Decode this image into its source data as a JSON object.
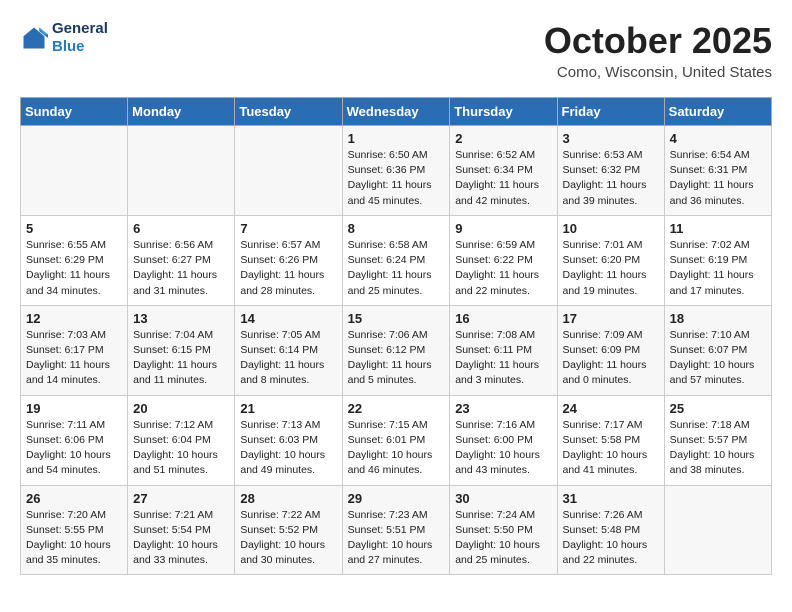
{
  "header": {
    "logo_line1": "General",
    "logo_line2": "Blue",
    "month": "October 2025",
    "location": "Como, Wisconsin, United States"
  },
  "weekdays": [
    "Sunday",
    "Monday",
    "Tuesday",
    "Wednesday",
    "Thursday",
    "Friday",
    "Saturday"
  ],
  "weeks": [
    [
      {
        "day": "",
        "text": ""
      },
      {
        "day": "",
        "text": ""
      },
      {
        "day": "",
        "text": ""
      },
      {
        "day": "1",
        "text": "Sunrise: 6:50 AM\nSunset: 6:36 PM\nDaylight: 11 hours\nand 45 minutes."
      },
      {
        "day": "2",
        "text": "Sunrise: 6:52 AM\nSunset: 6:34 PM\nDaylight: 11 hours\nand 42 minutes."
      },
      {
        "day": "3",
        "text": "Sunrise: 6:53 AM\nSunset: 6:32 PM\nDaylight: 11 hours\nand 39 minutes."
      },
      {
        "day": "4",
        "text": "Sunrise: 6:54 AM\nSunset: 6:31 PM\nDaylight: 11 hours\nand 36 minutes."
      }
    ],
    [
      {
        "day": "5",
        "text": "Sunrise: 6:55 AM\nSunset: 6:29 PM\nDaylight: 11 hours\nand 34 minutes."
      },
      {
        "day": "6",
        "text": "Sunrise: 6:56 AM\nSunset: 6:27 PM\nDaylight: 11 hours\nand 31 minutes."
      },
      {
        "day": "7",
        "text": "Sunrise: 6:57 AM\nSunset: 6:26 PM\nDaylight: 11 hours\nand 28 minutes."
      },
      {
        "day": "8",
        "text": "Sunrise: 6:58 AM\nSunset: 6:24 PM\nDaylight: 11 hours\nand 25 minutes."
      },
      {
        "day": "9",
        "text": "Sunrise: 6:59 AM\nSunset: 6:22 PM\nDaylight: 11 hours\nand 22 minutes."
      },
      {
        "day": "10",
        "text": "Sunrise: 7:01 AM\nSunset: 6:20 PM\nDaylight: 11 hours\nand 19 minutes."
      },
      {
        "day": "11",
        "text": "Sunrise: 7:02 AM\nSunset: 6:19 PM\nDaylight: 11 hours\nand 17 minutes."
      }
    ],
    [
      {
        "day": "12",
        "text": "Sunrise: 7:03 AM\nSunset: 6:17 PM\nDaylight: 11 hours\nand 14 minutes."
      },
      {
        "day": "13",
        "text": "Sunrise: 7:04 AM\nSunset: 6:15 PM\nDaylight: 11 hours\nand 11 minutes."
      },
      {
        "day": "14",
        "text": "Sunrise: 7:05 AM\nSunset: 6:14 PM\nDaylight: 11 hours\nand 8 minutes."
      },
      {
        "day": "15",
        "text": "Sunrise: 7:06 AM\nSunset: 6:12 PM\nDaylight: 11 hours\nand 5 minutes."
      },
      {
        "day": "16",
        "text": "Sunrise: 7:08 AM\nSunset: 6:11 PM\nDaylight: 11 hours\nand 3 minutes."
      },
      {
        "day": "17",
        "text": "Sunrise: 7:09 AM\nSunset: 6:09 PM\nDaylight: 11 hours\nand 0 minutes."
      },
      {
        "day": "18",
        "text": "Sunrise: 7:10 AM\nSunset: 6:07 PM\nDaylight: 10 hours\nand 57 minutes."
      }
    ],
    [
      {
        "day": "19",
        "text": "Sunrise: 7:11 AM\nSunset: 6:06 PM\nDaylight: 10 hours\nand 54 minutes."
      },
      {
        "day": "20",
        "text": "Sunrise: 7:12 AM\nSunset: 6:04 PM\nDaylight: 10 hours\nand 51 minutes."
      },
      {
        "day": "21",
        "text": "Sunrise: 7:13 AM\nSunset: 6:03 PM\nDaylight: 10 hours\nand 49 minutes."
      },
      {
        "day": "22",
        "text": "Sunrise: 7:15 AM\nSunset: 6:01 PM\nDaylight: 10 hours\nand 46 minutes."
      },
      {
        "day": "23",
        "text": "Sunrise: 7:16 AM\nSunset: 6:00 PM\nDaylight: 10 hours\nand 43 minutes."
      },
      {
        "day": "24",
        "text": "Sunrise: 7:17 AM\nSunset: 5:58 PM\nDaylight: 10 hours\nand 41 minutes."
      },
      {
        "day": "25",
        "text": "Sunrise: 7:18 AM\nSunset: 5:57 PM\nDaylight: 10 hours\nand 38 minutes."
      }
    ],
    [
      {
        "day": "26",
        "text": "Sunrise: 7:20 AM\nSunset: 5:55 PM\nDaylight: 10 hours\nand 35 minutes."
      },
      {
        "day": "27",
        "text": "Sunrise: 7:21 AM\nSunset: 5:54 PM\nDaylight: 10 hours\nand 33 minutes."
      },
      {
        "day": "28",
        "text": "Sunrise: 7:22 AM\nSunset: 5:52 PM\nDaylight: 10 hours\nand 30 minutes."
      },
      {
        "day": "29",
        "text": "Sunrise: 7:23 AM\nSunset: 5:51 PM\nDaylight: 10 hours\nand 27 minutes."
      },
      {
        "day": "30",
        "text": "Sunrise: 7:24 AM\nSunset: 5:50 PM\nDaylight: 10 hours\nand 25 minutes."
      },
      {
        "day": "31",
        "text": "Sunrise: 7:26 AM\nSunset: 5:48 PM\nDaylight: 10 hours\nand 22 minutes."
      },
      {
        "day": "",
        "text": ""
      }
    ]
  ]
}
